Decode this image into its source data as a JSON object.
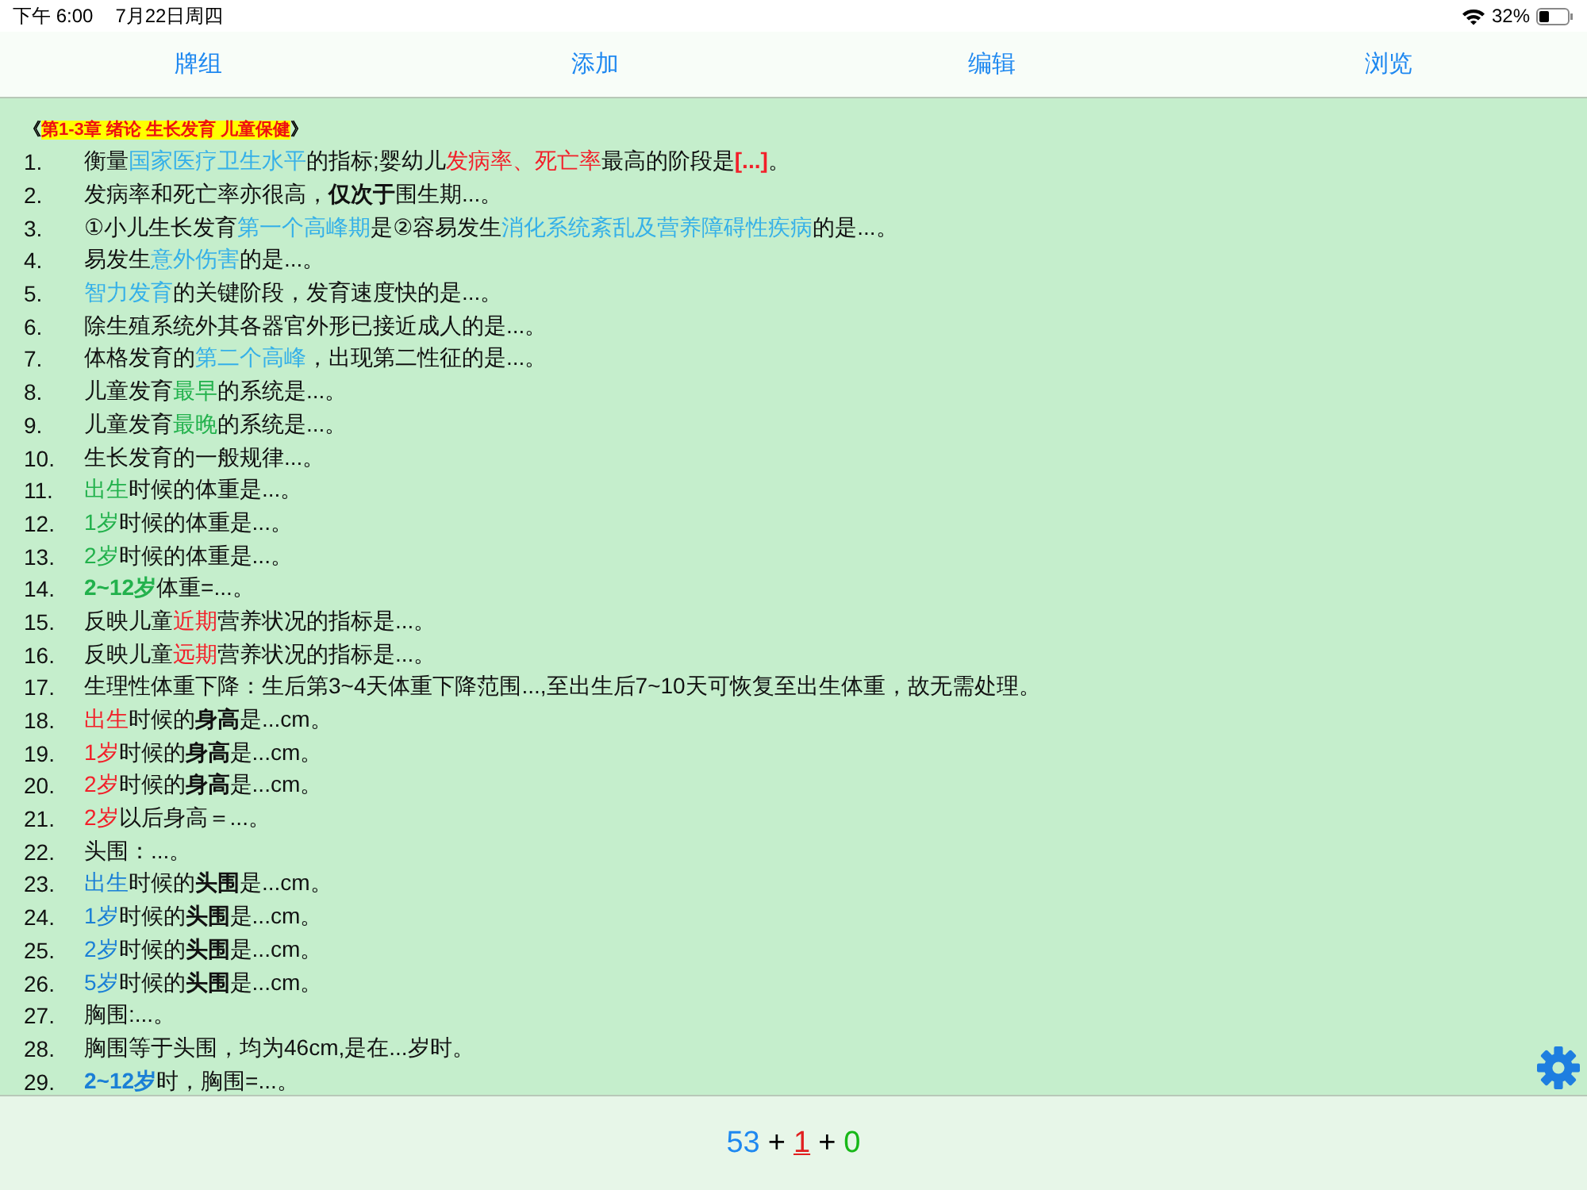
{
  "status_bar": {
    "time": "下午 6:00",
    "date": "7月22日周四",
    "battery": "32%"
  },
  "tabs": [
    {
      "label": "牌组"
    },
    {
      "label": "添加"
    },
    {
      "label": "编辑"
    },
    {
      "label": "浏览"
    }
  ],
  "chapter": {
    "open": "《",
    "title": "第1-3章 绪论 生长发育 儿童保健",
    "close": "》"
  },
  "items": [
    {
      "number": "1.",
      "segments": [
        {
          "text": "衡量",
          "bold": false
        },
        {
          "text": "国家医疗卫生水平",
          "color": "#35b0e8",
          "bold": false
        },
        {
          "text": "的指标;婴幼儿",
          "bold": false
        },
        {
          "text": "发病率、死亡率",
          "color": "#f2202a",
          "bold": false
        },
        {
          "text": "最高的阶段是",
          "bold": false
        },
        {
          "text": "[...]",
          "color": "#f2202a",
          "bold": true
        },
        {
          "text": "。",
          "bold": false
        }
      ]
    },
    {
      "number": "2.",
      "segments": [
        {
          "text": "发病率和死亡率亦很高，",
          "bold": false
        },
        {
          "text": "仅次于",
          "bold": true
        },
        {
          "text": "围生期...。",
          "bold": false
        }
      ]
    },
    {
      "number": "3.",
      "segments": [
        {
          "text": "①小儿生长发育",
          "bold": false
        },
        {
          "text": "第一个高峰期",
          "color": "#35b0e8",
          "bold": false
        },
        {
          "text": "是②容易发生",
          "bold": false
        },
        {
          "text": "消化系统紊乱及营养障碍性疾病",
          "color": "#35b0e8",
          "bold": false
        },
        {
          "text": "的是...。",
          "bold": false
        }
      ]
    },
    {
      "number": "4.",
      "segments": [
        {
          "text": "易发生",
          "bold": false
        },
        {
          "text": "意外伤害",
          "color": "#35b0e8",
          "bold": false
        },
        {
          "text": "的是...。",
          "bold": false
        }
      ]
    },
    {
      "number": "5.",
      "segments": [
        {
          "text": "智力发育",
          "color": "#35b0e8",
          "bold": false
        },
        {
          "text": "的关键阶段，发育速度快的是...。",
          "bold": false
        }
      ]
    },
    {
      "number": "6.",
      "segments": [
        {
          "text": "除生殖系统外其各器官外形已接近成人的是...。",
          "bold": false
        }
      ]
    },
    {
      "number": "7.",
      "segments": [
        {
          "text": "体格发育的",
          "bold": false
        },
        {
          "text": "第二个高峰",
          "color": "#35b0e8",
          "bold": false
        },
        {
          "text": "，出现第二性征的是...。",
          "bold": false
        }
      ]
    },
    {
      "number": "8.",
      "segments": [
        {
          "text": "儿童发育",
          "bold": false
        },
        {
          "text": "最早",
          "color": "#22b14c",
          "bold": false
        },
        {
          "text": "的系统是...。",
          "bold": false
        }
      ]
    },
    {
      "number": "9.",
      "segments": [
        {
          "text": "儿童发育",
          "bold": false
        },
        {
          "text": "最晚",
          "color": "#22b14c",
          "bold": false
        },
        {
          "text": "的系统是...。",
          "bold": false
        }
      ]
    },
    {
      "number": "10.",
      "segments": [
        {
          "text": "生长发育的一般规律...。",
          "bold": false
        }
      ]
    },
    {
      "number": "11.",
      "segments": [
        {
          "text": "出生",
          "color": "#22b14c",
          "bold": false
        },
        {
          "text": "时候的体重是...。",
          "bold": false
        }
      ]
    },
    {
      "number": "12.",
      "segments": [
        {
          "text": "1岁",
          "color": "#22b14c",
          "bold": false
        },
        {
          "text": "时候的体重是...。",
          "bold": false
        }
      ]
    },
    {
      "number": "13.",
      "segments": [
        {
          "text": "2岁",
          "color": "#22b14c",
          "bold": false
        },
        {
          "text": "时候的体重是...。",
          "bold": false
        }
      ]
    },
    {
      "number": "14.",
      "segments": [
        {
          "text": "2~12岁",
          "color": "#22b14c",
          "bold": true
        },
        {
          "text": "体重=...。",
          "bold": false
        }
      ]
    },
    {
      "number": "15.",
      "segments": [
        {
          "text": "反映儿童",
          "bold": false
        },
        {
          "text": "近期",
          "color": "#f2202a",
          "bold": false
        },
        {
          "text": "营养状况的指标是...。",
          "bold": false
        }
      ]
    },
    {
      "number": "16.",
      "segments": [
        {
          "text": "反映儿童",
          "bold": false
        },
        {
          "text": "远期",
          "color": "#f2202a",
          "bold": false
        },
        {
          "text": "营养状况的指标是...。",
          "bold": false
        }
      ]
    },
    {
      "number": "17.",
      "segments": [
        {
          "text": "生理性体重下降：生后第3~4天体重下降范围...,至出生后7~10天可恢复至出生体重，故无需处理。",
          "bold": false
        }
      ]
    },
    {
      "number": "18.",
      "segments": [
        {
          "text": "出生",
          "color": "#f2202a",
          "bold": false
        },
        {
          "text": "时候的",
          "bold": false
        },
        {
          "text": "身高",
          "bold": true
        },
        {
          "text": "是...cm。",
          "bold": false
        }
      ]
    },
    {
      "number": "19.",
      "segments": [
        {
          "text": "1岁",
          "color": "#f2202a",
          "bold": false
        },
        {
          "text": "时候的",
          "bold": false
        },
        {
          "text": "身高",
          "bold": true
        },
        {
          "text": "是...cm。",
          "bold": false
        }
      ]
    },
    {
      "number": "20.",
      "segments": [
        {
          "text": "2岁",
          "color": "#f2202a",
          "bold": false
        },
        {
          "text": "时候的",
          "bold": false
        },
        {
          "text": "身高",
          "bold": true
        },
        {
          "text": "是...cm。",
          "bold": false
        }
      ]
    },
    {
      "number": "21.",
      "segments": [
        {
          "text": "2岁",
          "color": "#f2202a",
          "bold": false
        },
        {
          "text": "以后身高＝...。",
          "bold": false
        }
      ]
    },
    {
      "number": "22.",
      "segments": [
        {
          "text": "头围：...。",
          "bold": false
        }
      ]
    },
    {
      "number": "23.",
      "segments": [
        {
          "text": "出生",
          "color": "#1a7fd6",
          "bold": false
        },
        {
          "text": "时候的",
          "bold": false
        },
        {
          "text": "头围",
          "bold": true
        },
        {
          "text": "是...cm。",
          "bold": false
        }
      ]
    },
    {
      "number": "24.",
      "segments": [
        {
          "text": "1岁",
          "color": "#1a7fd6",
          "bold": false
        },
        {
          "text": "时候的",
          "bold": false
        },
        {
          "text": "头围",
          "bold": true
        },
        {
          "text": "是...cm。",
          "bold": false
        }
      ]
    },
    {
      "number": "25.",
      "segments": [
        {
          "text": "2岁",
          "color": "#1a7fd6",
          "bold": false
        },
        {
          "text": "时候的",
          "bold": false
        },
        {
          "text": "头围",
          "bold": true
        },
        {
          "text": "是...cm。",
          "bold": false
        }
      ]
    },
    {
      "number": "26.",
      "segments": [
        {
          "text": "5岁",
          "color": "#1a7fd6",
          "bold": false
        },
        {
          "text": "时候的",
          "bold": false
        },
        {
          "text": "头围",
          "bold": true
        },
        {
          "text": "是...cm。",
          "bold": false
        }
      ]
    },
    {
      "number": "27.",
      "segments": [
        {
          "text": "胸围:...。",
          "bold": false
        }
      ]
    },
    {
      "number": "28.",
      "segments": [
        {
          "text": "胸围等于头围，均为46cm,是在...岁时。",
          "bold": false
        }
      ]
    },
    {
      "number": "29.",
      "segments": [
        {
          "text": "2~12岁",
          "color": "#1a7fd6",
          "bold": true
        },
        {
          "text": "时，胸围=...。",
          "bold": false
        }
      ]
    }
  ],
  "counts": [
    {
      "text": "53",
      "color": "#1e88f0",
      "underlined": false
    },
    {
      "text": "1",
      "color": "#e02020",
      "underlined": true
    },
    {
      "text": "0",
      "color": "#18b818",
      "underlined": false
    }
  ],
  "separators": [
    "+",
    "+"
  ]
}
